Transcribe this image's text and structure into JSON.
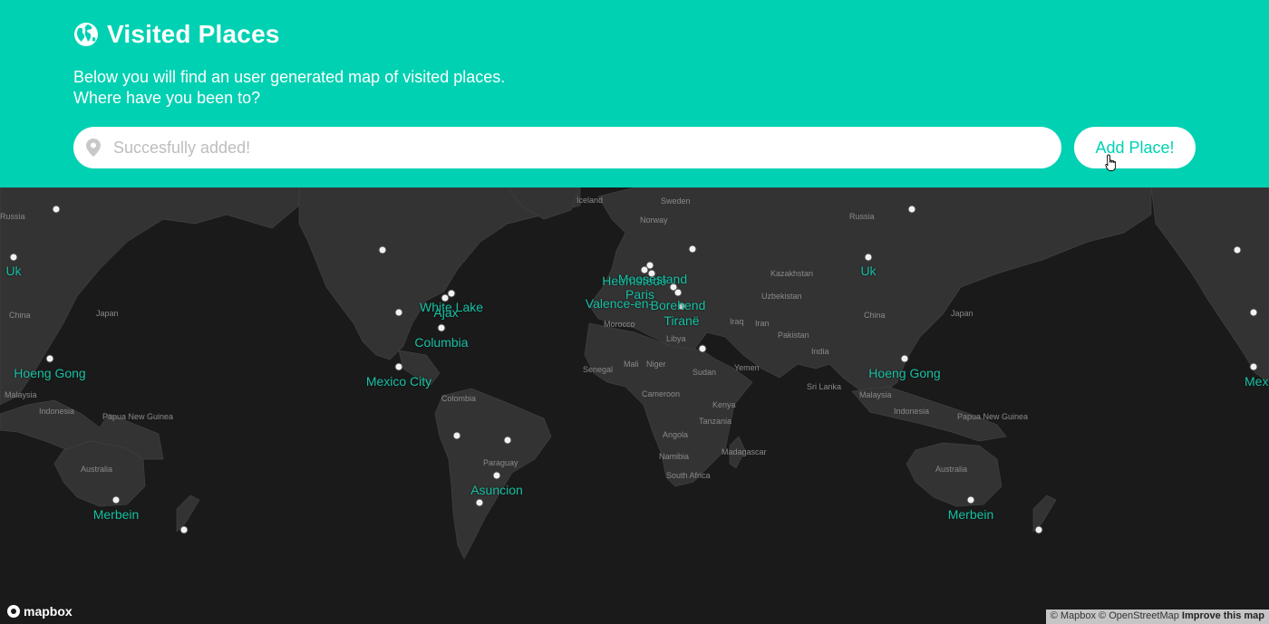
{
  "header": {
    "title": "Visited Places",
    "subtitle_line1": "Below you will find an user generated map of visited places.",
    "subtitle_line2": "Where have you been to?",
    "icon": "globe-icon"
  },
  "search": {
    "placeholder": "Succesfully added!",
    "value": "",
    "icon": "map-pin-icon"
  },
  "add_button": {
    "label": "Add Place!"
  },
  "colors": {
    "accent": "#00d1b2",
    "map_bg": "#1a1a1a",
    "land": "#333333",
    "place_text": "#16c0a3"
  },
  "map": {
    "countries": [
      "Russia",
      "China",
      "Japan",
      "Malaysia",
      "Indonesia",
      "Papua New Guinea",
      "Australia",
      "Iceland",
      "Sweden",
      "Norway",
      "Morocco",
      "Libya",
      "Senegal",
      "Mali",
      "Niger",
      "Sudan",
      "Cameroon",
      "Colombia",
      "Kenya",
      "Tanzania",
      "Angola",
      "Namibia",
      "South Africa",
      "Madagascar",
      "Iraq",
      "Iran",
      "Pakistan",
      "India",
      "Yemen",
      "Sri Lanka",
      "Kazakhstan",
      "Uzbekistan",
      "Russia",
      "China",
      "Japan",
      "Malaysia",
      "Indonesia",
      "Papua New Guinea",
      "Australia",
      "Paraguay"
    ],
    "places": [
      "Uk",
      "Hoeng Gong",
      "Merbein",
      "White Lake",
      "Ajax",
      "Columbia",
      "Mexico City",
      "Asuncion",
      "Valence-en-",
      "Paris",
      "Borehend",
      "Tiranë",
      "Heemstede",
      "Moosestand",
      "Uk",
      "Hoeng Gong",
      "Merbein",
      "Mexico C"
    ]
  },
  "footer": {
    "logo": "mapbox",
    "attribution": "© Mapbox © OpenStreetMap",
    "improve": "Improve this map"
  }
}
